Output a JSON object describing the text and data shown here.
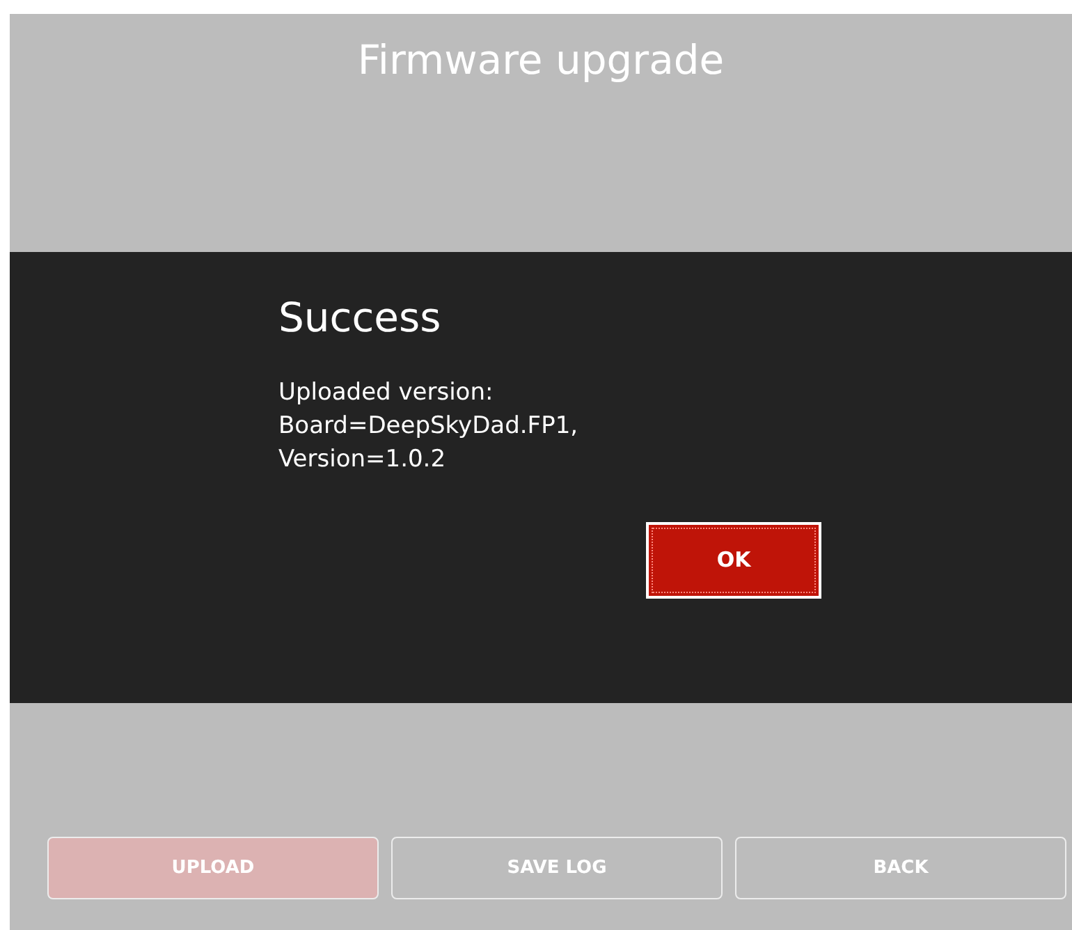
{
  "window": {
    "title": "Firmware upgrade"
  },
  "dialog": {
    "title": "Success",
    "message_lines": [
      "Uploaded version:",
      "Board=DeepSkyDad.FP1,",
      "Version=1.0.2"
    ],
    "button": {
      "label": "OK",
      "focused": true
    }
  },
  "buttons": [
    {
      "label": "UPLOAD",
      "kind": "primary"
    },
    {
      "label": "SAVE LOG",
      "kind": "secondary"
    },
    {
      "label": "BACK",
      "kind": "secondary"
    }
  ]
}
